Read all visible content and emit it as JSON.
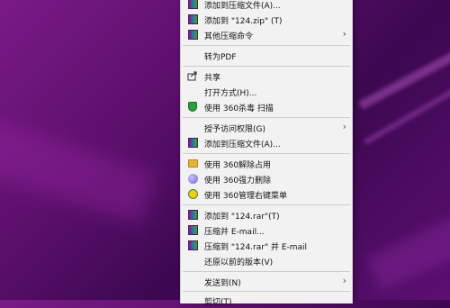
{
  "context_menu": {
    "items": [
      {
        "label": "添加到压缩文件(A)...",
        "icon": "winrar-icon",
        "submenu": false,
        "top": 0
      },
      {
        "label": "添加到 \"124.zip\" (T)",
        "icon": "winrar-icon",
        "submenu": false
      },
      {
        "label": "其他压缩命令",
        "icon": "winrar-icon",
        "submenu": true
      },
      {
        "label": "转为PDF",
        "icon": "",
        "submenu": false
      },
      {
        "label": "共享",
        "icon": "share-icon",
        "submenu": false
      },
      {
        "label": "打开方式(H)...",
        "icon": "",
        "submenu": false
      },
      {
        "label": "使用 360杀毒 扫描",
        "icon": "360-shield-icon",
        "submenu": false
      },
      {
        "label": "授予访问权限(G)",
        "icon": "",
        "submenu": true
      },
      {
        "label": "添加到压缩文件(A)...",
        "icon": "winrar-icon",
        "submenu": false
      },
      {
        "label": "使用 360解除占用",
        "icon": "360-unlock-icon",
        "submenu": false
      },
      {
        "label": "使用 360强力删除",
        "icon": "360-delete-icon",
        "submenu": false
      },
      {
        "label": "使用 360管理右键菜单",
        "icon": "360-menu-manager-icon",
        "submenu": false
      },
      {
        "label": "添加到 \"124.rar\"(T)",
        "icon": "winrar-icon",
        "submenu": false
      },
      {
        "label": "压缩并 E-mail...",
        "icon": "winrar-icon",
        "submenu": false
      },
      {
        "label": "压缩到 \"124.rar\" 并 E-mail",
        "icon": "winrar-icon",
        "submenu": false
      },
      {
        "label": "还原以前的版本(V)",
        "icon": "",
        "submenu": false
      },
      {
        "label": "发送到(N)",
        "icon": "",
        "submenu": true
      },
      {
        "label": "剪切(T)",
        "icon": "",
        "submenu": false
      }
    ],
    "submenu_arrow": "›",
    "colors": {
      "menu_bg": "#f2f2f2",
      "separator": "#cdcdcd",
      "desktop": "#5a0f6b"
    }
  }
}
